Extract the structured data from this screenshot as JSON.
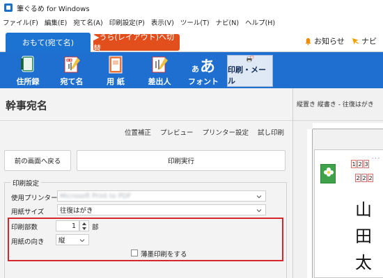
{
  "window": {
    "title": "筆ぐるめ for Windows"
  },
  "menu": [
    "ファイル(F)",
    "編集(E)",
    "宛て名(A)",
    "印刷設定(P)",
    "表示(V)",
    "ツール(T)",
    "ナビ(N)",
    "ヘルプ(H)"
  ],
  "modes": {
    "front": "おもて(宛て名)",
    "back": "▶うら(レイアウト)へ切替"
  },
  "header_links": {
    "notice": "お知らせ",
    "navi": "ナビ"
  },
  "toolbar": [
    {
      "label": "住所録",
      "icon": "address-book-icon"
    },
    {
      "label": "宛て名",
      "icon": "address-card-icon"
    },
    {
      "label": "用 紙",
      "icon": "paper-icon"
    },
    {
      "label": "差出人",
      "icon": "sender-icon"
    },
    {
      "label": "フォント",
      "icon": "font-icon",
      "glyph": "あ"
    },
    {
      "label": "印刷・メール",
      "icon": "printer-mail-icon",
      "active": true
    }
  ],
  "panel": {
    "title": "幹事宛名",
    "links": [
      "位置補正",
      "プレビュー",
      "プリンター設定",
      "試し印刷"
    ],
    "back_button": "前の画面へ戻る",
    "run_button": "印刷実行",
    "group_title": "印刷設定",
    "printer_label": "使用プリンター",
    "printer_value": "Microsoft Print to PDF",
    "paper_size_label": "用紙サイズ",
    "paper_size_value": "往復はがき",
    "copies_label": "印刷部数",
    "copies_value": "1",
    "copies_unit": "部",
    "orientation_label": "用紙の向き",
    "orientation_value": "縦",
    "light_print_label": "薄墨印刷をする",
    "light_print_checked": false
  },
  "preview": {
    "title": "縦置き 縦書き - 往復はがき",
    "zip_top": [
      "1",
      "2",
      "3"
    ],
    "zip_bottom": [
      "2",
      "2",
      "2"
    ],
    "name_chars": [
      "山",
      "田",
      "太"
    ]
  },
  "colors": {
    "accent_blue": "#1e6fd0",
    "back_tab": "#e24f1c",
    "highlight": "#d6262b"
  }
}
